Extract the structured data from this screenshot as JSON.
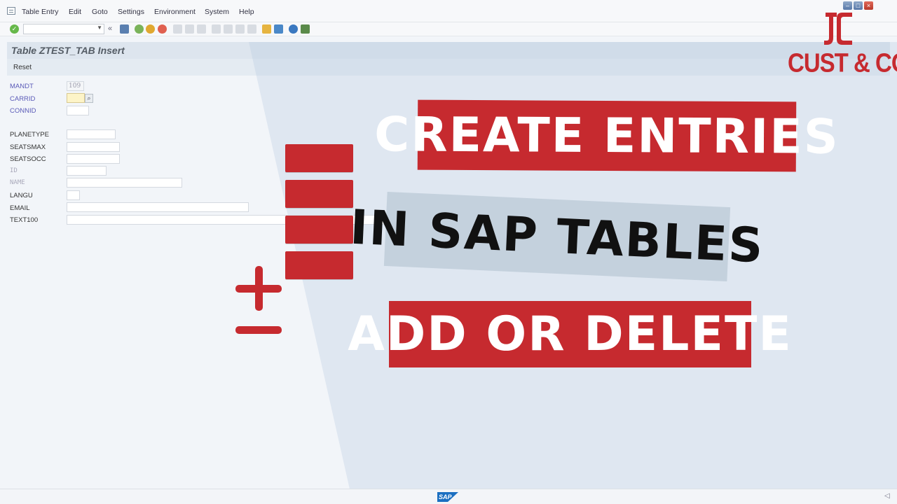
{
  "menu": {
    "items": [
      "Table Entry",
      "Edit",
      "Goto",
      "Settings",
      "Environment",
      "System",
      "Help"
    ]
  },
  "toolbar": {
    "command_value": "",
    "icons": [
      "save-icon",
      "back-icon",
      "exit-icon",
      "cancel-icon",
      "print-icon",
      "find-icon",
      "find-next-icon",
      "first-page-icon",
      "prev-page-icon",
      "next-page-icon",
      "last-page-icon",
      "new-session-icon",
      "shortcut-icon",
      "help-icon",
      "customize-layout-icon"
    ]
  },
  "title": "Table ZTEST_TAB Insert",
  "appbar": {
    "reset_label": "Reset"
  },
  "form": {
    "fields": [
      {
        "label": "MANDT",
        "value": "109"
      },
      {
        "label": "CARRID",
        "value": ""
      },
      {
        "label": "CONNID",
        "value": ""
      },
      {
        "label": "PLANETYPE",
        "value": ""
      },
      {
        "label": "SEATSMAX",
        "value": ""
      },
      {
        "label": "SEATSOCC",
        "value": ""
      },
      {
        "label": "ID",
        "value": ""
      },
      {
        "label": "NAME",
        "value": ""
      },
      {
        "label": "LANGU",
        "value": ""
      },
      {
        "label": "EMAIL",
        "value": ""
      },
      {
        "label": "TEXT100",
        "value": ""
      }
    ]
  },
  "overlay": {
    "banner1": "CREATE ENTRIES",
    "banner2": "IN SAP TABLES",
    "banner3": "ADD OR DELETE",
    "logo_text": "CUST & CODE"
  },
  "statusbar": {
    "brand": "SAP"
  },
  "colors": {
    "brand_red": "#c62a2f",
    "banner_gray": "#c4d1dd",
    "key_label": "#5a5ab8",
    "sap_blue": "#1b6fc1"
  }
}
